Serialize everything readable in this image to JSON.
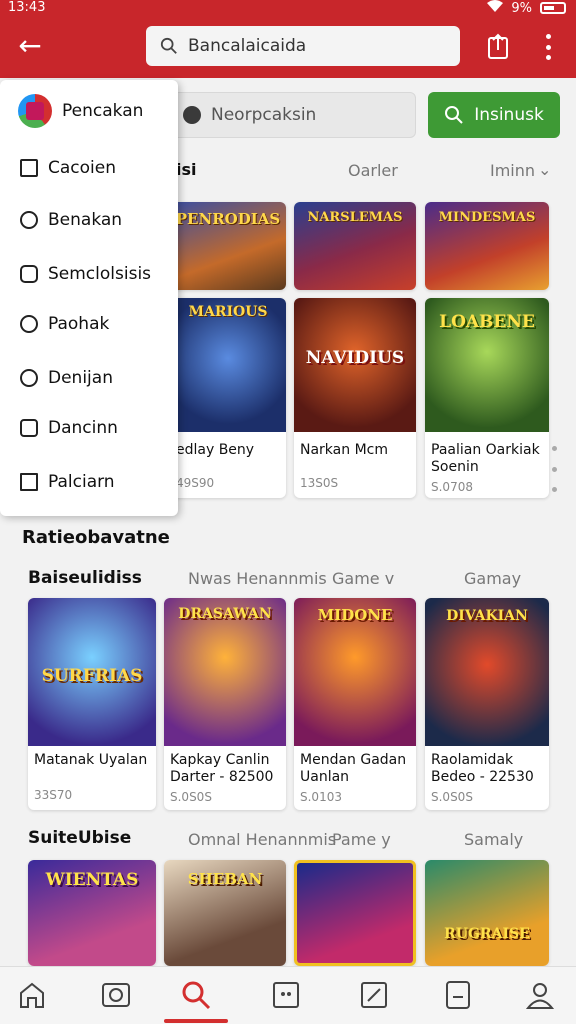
{
  "status": {
    "time": "13:43",
    "battery": "9%"
  },
  "topbar": {
    "search_text": "Bancalaicaida",
    "bg": "#c8262b"
  },
  "secondary": {
    "search_text": "Neorpcaksin",
    "button_label": "Insinusk"
  },
  "drawer": {
    "header": "Pencakan",
    "items": [
      "Cacoien",
      "Benakan",
      "Semclolsisis",
      "Paohak",
      "Denijan",
      "Dancinn",
      "Palciarn"
    ]
  },
  "row1": {
    "title_partial": "isi",
    "col_mid": "Oarler",
    "col_right": "Iminn"
  },
  "row1_cards": [
    {
      "art": "PENRODIAS",
      "name": "",
      "meta": ""
    },
    {
      "art": "NARSLEMAS",
      "name": "",
      "meta": ""
    },
    {
      "art": "MINDESMAS",
      "name": "",
      "meta": ""
    }
  ],
  "row2_cards": [
    {
      "art": "MARIOUS",
      "name": "edlay Beny",
      "meta": "49S90"
    },
    {
      "art": "NAVIDIUS",
      "name": "Narkan Mcm",
      "meta": "13S0S"
    },
    {
      "art": "LOABENE",
      "name": "Paalian Oarkiak Soenin",
      "meta": "S.0708"
    }
  ],
  "section1": {
    "title": "Ratieobavatne"
  },
  "section2": {
    "title": "Baiseulidiss",
    "col1": "Nwas Henannmis",
    "col2": "Game v",
    "col3": "Gamay",
    "cards": [
      {
        "art": "SURFRIAS",
        "name": "Matanak Uyalan",
        "meta": "33S70"
      },
      {
        "art": "DRASAWAN",
        "name": "Kapkay Canlin Darter - 82500",
        "meta": "S.0S0S"
      },
      {
        "art": "MIDONE",
        "name": "Mendan Gadan Uanlan",
        "meta": "S.0103"
      },
      {
        "art": "DIVAKIAN",
        "name": "Raolamidak Bedeo - 22530",
        "meta": "S.0S0S"
      }
    ]
  },
  "section3": {
    "title": "SuiteUbise",
    "col1": "Omnal Henannmis",
    "col2": "Pame y",
    "col3": "Samaly",
    "cards": [
      {
        "art": "WIENTAS"
      },
      {
        "art": "SHEBAN"
      },
      {
        "art": ""
      },
      {
        "art": "RUGRAISE"
      }
    ]
  },
  "colors": {
    "accent": "#c8262b",
    "green": "#3e9a35",
    "nav_active": "#d32f2f"
  }
}
